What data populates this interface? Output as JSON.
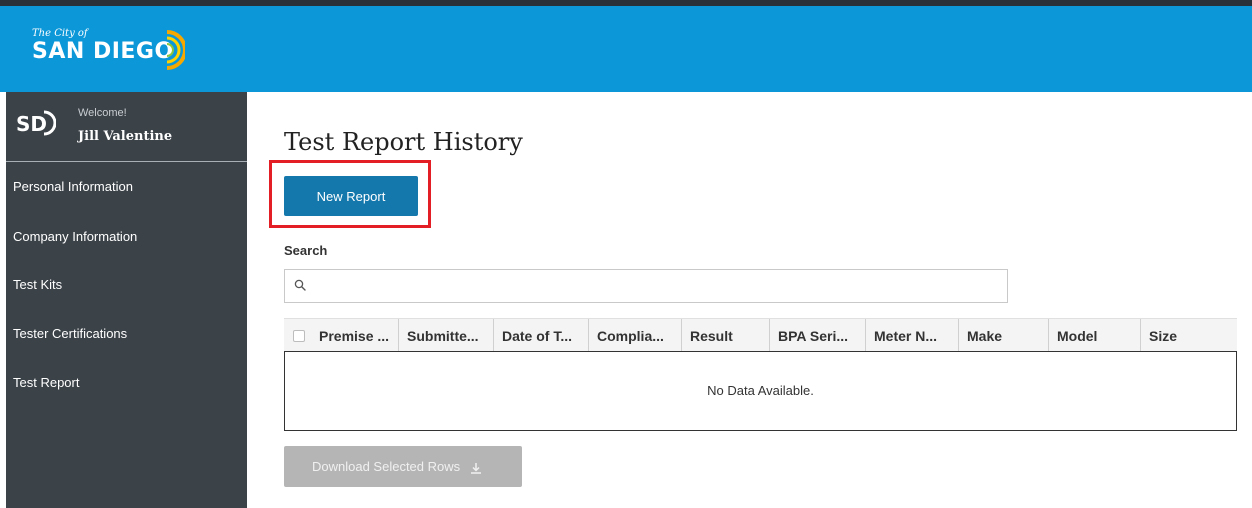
{
  "header": {
    "logo_small": "The City of",
    "logo_big": "SAN DIEGO"
  },
  "sidebar": {
    "logo_text": "SD",
    "welcome": "Welcome!",
    "user_name": "Jill Valentine",
    "items": [
      {
        "label": "Personal Information"
      },
      {
        "label": "Company Information"
      },
      {
        "label": "Test Kits"
      },
      {
        "label": "Tester Certifications"
      },
      {
        "label": "Test Report"
      }
    ]
  },
  "main": {
    "title": "Test Report History",
    "new_report_label": "New Report",
    "search_label": "Search",
    "search_value": "",
    "search_icon": "search-icon",
    "table": {
      "columns": [
        "Premise ...",
        "Submitte...",
        "Date of T...",
        "Complia...",
        "Result",
        "BPA Seri...",
        "Meter N...",
        "Make",
        "Model",
        "Size"
      ],
      "empty_message": "No Data Available."
    },
    "download_label": "Download Selected Rows",
    "download_icon": "download-icon"
  },
  "colors": {
    "header_bg": "#0c97d9",
    "sidebar_bg": "#3b4248",
    "primary_button": "#1478ad",
    "disabled_button": "#b5b5b5",
    "highlight_border": "#e31e24"
  }
}
